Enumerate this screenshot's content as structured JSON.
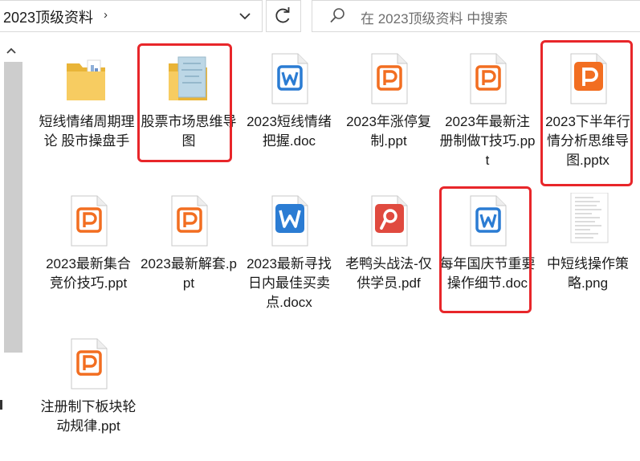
{
  "address": {
    "path": "2023顶级资料",
    "chevron": "›"
  },
  "search": {
    "placeholder": "在 2023顶级资料 中搜索"
  },
  "files": [
    {
      "name": "短线情绪周期理论 股市操盘手",
      "type": "folder-blue"
    },
    {
      "name": "股票市场思维导图",
      "type": "folder-map"
    },
    {
      "name": "2023短线情绪把握.doc",
      "type": "word"
    },
    {
      "name": "2023年涨停复制.ppt",
      "type": "ppt"
    },
    {
      "name": "2023年最新注册制做T技巧.ppt",
      "type": "ppt"
    },
    {
      "name": "2023下半年行情分析思维导图.pptx",
      "type": "ppt-filled"
    },
    {
      "name": "2023最新集合竞价技巧.ppt",
      "type": "ppt"
    },
    {
      "name": "2023最新解套.ppt",
      "type": "ppt"
    },
    {
      "name": "2023最新寻找日内最佳买卖点.docx",
      "type": "word-filled"
    },
    {
      "name": "老鸭头战法-仅供学员.pdf",
      "type": "pdf"
    },
    {
      "name": "每年国庆节重要操作细节.doc",
      "type": "word"
    },
    {
      "name": "中短线操作策略.png",
      "type": "image"
    },
    {
      "name": "注册制下板块轮动规律.ppt",
      "type": "ppt"
    }
  ],
  "highlighted": [
    "股票市场思维导图",
    "2023下半年行情分析思维导图.pptx",
    "每年国庆节重要操作细节.doc"
  ],
  "colors": {
    "highlight": "#e8262a",
    "ppt_orange": "#f26e21",
    "word_blue": "#2b7cd3",
    "pdf_red": "#e04a3f",
    "folder_yellow": "#f7cc61"
  }
}
